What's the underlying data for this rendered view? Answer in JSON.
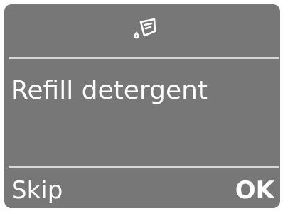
{
  "header": {
    "icon": "detergent-icon"
  },
  "message": {
    "text": "Refill detergent"
  },
  "softkeys": {
    "left_label": "Skip",
    "right_label": "OK"
  },
  "colors": {
    "screen_background": "#777777",
    "text": "#ffffff",
    "divider": "#d8d8d8"
  }
}
